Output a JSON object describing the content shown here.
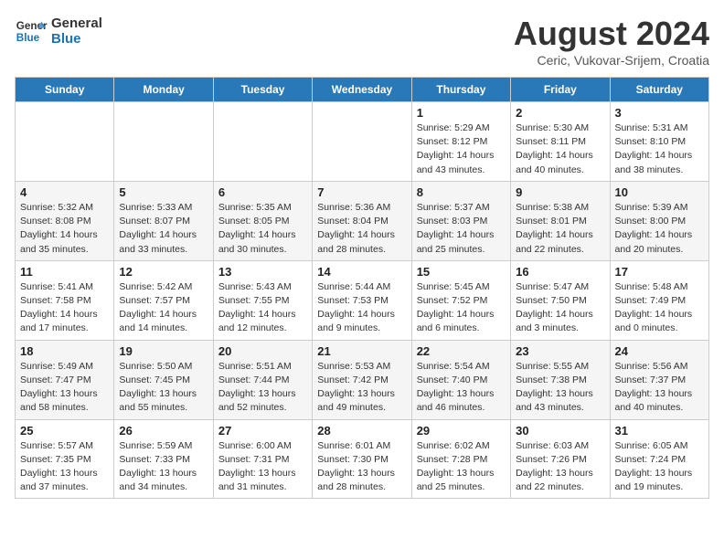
{
  "header": {
    "logo_line1": "General",
    "logo_line2": "Blue",
    "month": "August 2024",
    "location": "Ceric, Vukovar-Srijem, Croatia"
  },
  "weekdays": [
    "Sunday",
    "Monday",
    "Tuesday",
    "Wednesday",
    "Thursday",
    "Friday",
    "Saturday"
  ],
  "weeks": [
    [
      {
        "day": "",
        "info": ""
      },
      {
        "day": "",
        "info": ""
      },
      {
        "day": "",
        "info": ""
      },
      {
        "day": "",
        "info": ""
      },
      {
        "day": "1",
        "info": "Sunrise: 5:29 AM\nSunset: 8:12 PM\nDaylight: 14 hours\nand 43 minutes."
      },
      {
        "day": "2",
        "info": "Sunrise: 5:30 AM\nSunset: 8:11 PM\nDaylight: 14 hours\nand 40 minutes."
      },
      {
        "day": "3",
        "info": "Sunrise: 5:31 AM\nSunset: 8:10 PM\nDaylight: 14 hours\nand 38 minutes."
      }
    ],
    [
      {
        "day": "4",
        "info": "Sunrise: 5:32 AM\nSunset: 8:08 PM\nDaylight: 14 hours\nand 35 minutes."
      },
      {
        "day": "5",
        "info": "Sunrise: 5:33 AM\nSunset: 8:07 PM\nDaylight: 14 hours\nand 33 minutes."
      },
      {
        "day": "6",
        "info": "Sunrise: 5:35 AM\nSunset: 8:05 PM\nDaylight: 14 hours\nand 30 minutes."
      },
      {
        "day": "7",
        "info": "Sunrise: 5:36 AM\nSunset: 8:04 PM\nDaylight: 14 hours\nand 28 minutes."
      },
      {
        "day": "8",
        "info": "Sunrise: 5:37 AM\nSunset: 8:03 PM\nDaylight: 14 hours\nand 25 minutes."
      },
      {
        "day": "9",
        "info": "Sunrise: 5:38 AM\nSunset: 8:01 PM\nDaylight: 14 hours\nand 22 minutes."
      },
      {
        "day": "10",
        "info": "Sunrise: 5:39 AM\nSunset: 8:00 PM\nDaylight: 14 hours\nand 20 minutes."
      }
    ],
    [
      {
        "day": "11",
        "info": "Sunrise: 5:41 AM\nSunset: 7:58 PM\nDaylight: 14 hours\nand 17 minutes."
      },
      {
        "day": "12",
        "info": "Sunrise: 5:42 AM\nSunset: 7:57 PM\nDaylight: 14 hours\nand 14 minutes."
      },
      {
        "day": "13",
        "info": "Sunrise: 5:43 AM\nSunset: 7:55 PM\nDaylight: 14 hours\nand 12 minutes."
      },
      {
        "day": "14",
        "info": "Sunrise: 5:44 AM\nSunset: 7:53 PM\nDaylight: 14 hours\nand 9 minutes."
      },
      {
        "day": "15",
        "info": "Sunrise: 5:45 AM\nSunset: 7:52 PM\nDaylight: 14 hours\nand 6 minutes."
      },
      {
        "day": "16",
        "info": "Sunrise: 5:47 AM\nSunset: 7:50 PM\nDaylight: 14 hours\nand 3 minutes."
      },
      {
        "day": "17",
        "info": "Sunrise: 5:48 AM\nSunset: 7:49 PM\nDaylight: 14 hours\nand 0 minutes."
      }
    ],
    [
      {
        "day": "18",
        "info": "Sunrise: 5:49 AM\nSunset: 7:47 PM\nDaylight: 13 hours\nand 58 minutes."
      },
      {
        "day": "19",
        "info": "Sunrise: 5:50 AM\nSunset: 7:45 PM\nDaylight: 13 hours\nand 55 minutes."
      },
      {
        "day": "20",
        "info": "Sunrise: 5:51 AM\nSunset: 7:44 PM\nDaylight: 13 hours\nand 52 minutes."
      },
      {
        "day": "21",
        "info": "Sunrise: 5:53 AM\nSunset: 7:42 PM\nDaylight: 13 hours\nand 49 minutes."
      },
      {
        "day": "22",
        "info": "Sunrise: 5:54 AM\nSunset: 7:40 PM\nDaylight: 13 hours\nand 46 minutes."
      },
      {
        "day": "23",
        "info": "Sunrise: 5:55 AM\nSunset: 7:38 PM\nDaylight: 13 hours\nand 43 minutes."
      },
      {
        "day": "24",
        "info": "Sunrise: 5:56 AM\nSunset: 7:37 PM\nDaylight: 13 hours\nand 40 minutes."
      }
    ],
    [
      {
        "day": "25",
        "info": "Sunrise: 5:57 AM\nSunset: 7:35 PM\nDaylight: 13 hours\nand 37 minutes."
      },
      {
        "day": "26",
        "info": "Sunrise: 5:59 AM\nSunset: 7:33 PM\nDaylight: 13 hours\nand 34 minutes."
      },
      {
        "day": "27",
        "info": "Sunrise: 6:00 AM\nSunset: 7:31 PM\nDaylight: 13 hours\nand 31 minutes."
      },
      {
        "day": "28",
        "info": "Sunrise: 6:01 AM\nSunset: 7:30 PM\nDaylight: 13 hours\nand 28 minutes."
      },
      {
        "day": "29",
        "info": "Sunrise: 6:02 AM\nSunset: 7:28 PM\nDaylight: 13 hours\nand 25 minutes."
      },
      {
        "day": "30",
        "info": "Sunrise: 6:03 AM\nSunset: 7:26 PM\nDaylight: 13 hours\nand 22 minutes."
      },
      {
        "day": "31",
        "info": "Sunrise: 6:05 AM\nSunset: 7:24 PM\nDaylight: 13 hours\nand 19 minutes."
      }
    ]
  ]
}
